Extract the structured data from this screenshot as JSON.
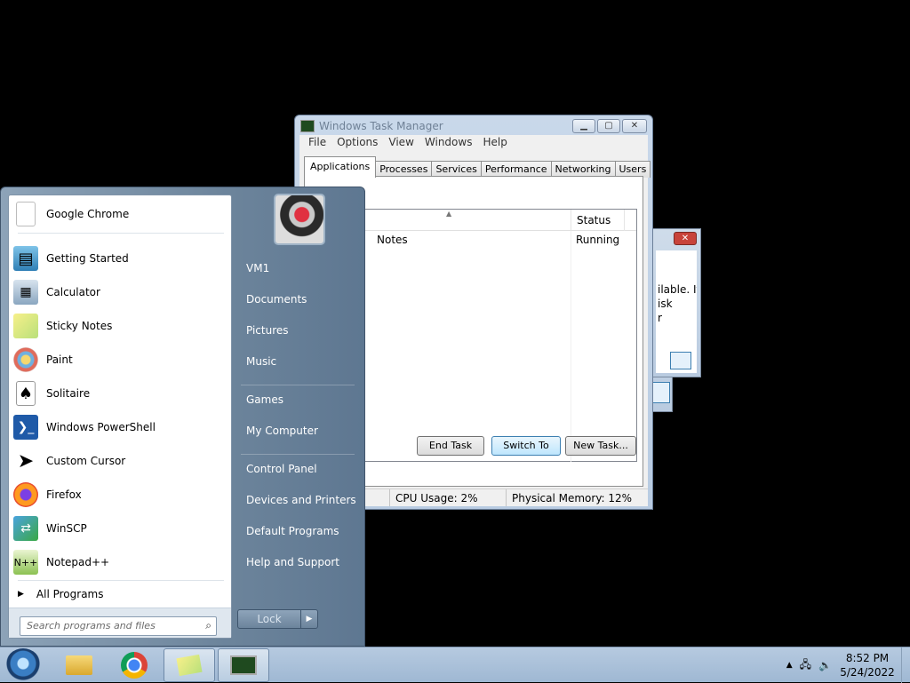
{
  "dialog_partial": {
    "line1": "ilable. It",
    "line2": "isk",
    "line3": "r"
  },
  "task_manager": {
    "title": "Windows Task Manager",
    "menu": [
      "File",
      "Options",
      "View",
      "Windows",
      "Help"
    ],
    "tabs": [
      "Applications",
      "Processes",
      "Services",
      "Performance",
      "Networking",
      "Users"
    ],
    "active_tab": "Applications",
    "columns": {
      "task": "",
      "status": "Status"
    },
    "rows": [
      {
        "task": "Notes",
        "status": "Running"
      }
    ],
    "buttons": {
      "end_task": "End Task",
      "switch_to": "Switch To",
      "new_task": "New Task..."
    },
    "status": {
      "processes": "",
      "cpu": "CPU Usage: 2%",
      "memory": "Physical Memory: 12%"
    }
  },
  "start_menu": {
    "programs": [
      {
        "label": "Google Chrome",
        "icon": "blank-page-icon"
      },
      {
        "label": "Getting Started",
        "icon": "getting-started-icon"
      },
      {
        "label": "Calculator",
        "icon": "calculator-icon"
      },
      {
        "label": "Sticky Notes",
        "icon": "sticky-notes-icon"
      },
      {
        "label": "Paint",
        "icon": "paint-icon"
      },
      {
        "label": "Solitaire",
        "icon": "solitaire-icon"
      },
      {
        "label": "Windows PowerShell",
        "icon": "powershell-icon"
      },
      {
        "label": "Custom Cursor",
        "icon": "cursor-icon"
      },
      {
        "label": "Firefox",
        "icon": "firefox-icon"
      },
      {
        "label": "WinSCP",
        "icon": "winscp-icon"
      },
      {
        "label": "Notepad++",
        "icon": "notepadpp-icon"
      }
    ],
    "all_programs": "All Programs",
    "search_placeholder": "Search programs and files",
    "right_links": [
      "VM1",
      "Documents",
      "Pictures",
      "Music",
      "Games",
      "My Computer",
      "Control Panel",
      "Devices and Printers",
      "Default Programs",
      "Help and Support"
    ],
    "lock_label": "Lock"
  },
  "taskbar": {
    "apps": [
      "explorer-icon",
      "chrome-icon",
      "sticky-notes-icon",
      "task-manager-icon"
    ],
    "time": "8:52 PM",
    "date": "5/24/2022"
  }
}
